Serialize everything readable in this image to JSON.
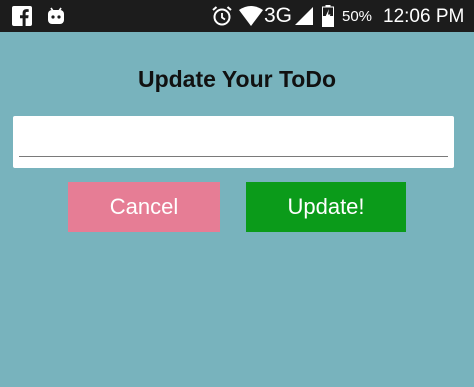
{
  "status_bar": {
    "battery_percent": "50%",
    "network": "3G",
    "time": "12:06 PM",
    "background_color": "#1c1c1c",
    "left_icons": [
      "facebook-icon",
      "android-notification-icon"
    ],
    "right_icons": [
      "alarm-icon",
      "wifi-icon",
      "cell-signal-icon",
      "battery-charging-icon"
    ]
  },
  "dialog": {
    "title": "Update Your ToDo",
    "input": {
      "value": "",
      "placeholder": ""
    },
    "cancel_label": "Cancel",
    "update_label": "Update!"
  },
  "colors": {
    "background": "#78b3bd",
    "cancel_button": "#e67d95",
    "update_button": "#0b9b1a"
  }
}
